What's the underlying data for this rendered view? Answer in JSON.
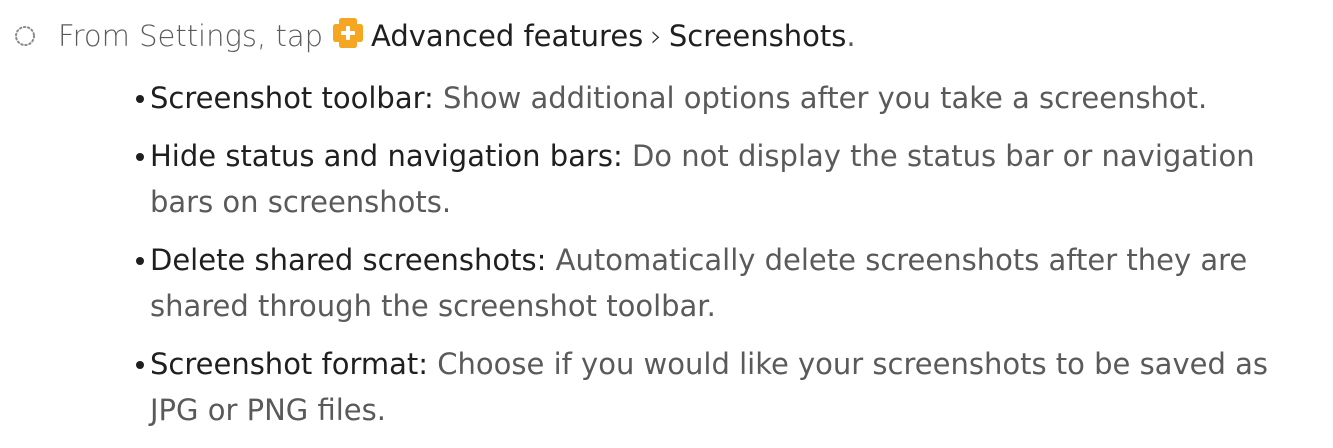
{
  "step": {
    "prefix": "From Settings, tap",
    "menu": "Advanced features",
    "chevron": "›",
    "submenu": "Screenshots",
    "suffix": ".",
    "bullet_icon": "dotted-circle-icon",
    "app_icon": "advanced-features-icon",
    "app_icon_color": "#f5a623"
  },
  "items": [
    {
      "term": "Screenshot toolbar",
      "separator": ":",
      "description": " Show additional options after you take a screenshot."
    },
    {
      "term": "Hide status and navigation bars",
      "separator": ":",
      "description": " Do not display the status bar or navigation bars on screenshots."
    },
    {
      "term": "Delete shared screenshots",
      "separator": ":",
      "description": " Automatically delete screenshots after they are shared through the screenshot toolbar."
    },
    {
      "term": "Screenshot format",
      "separator": ":",
      "description": " Choose if you would like your screenshots to be saved as JPG or PNG files."
    }
  ]
}
